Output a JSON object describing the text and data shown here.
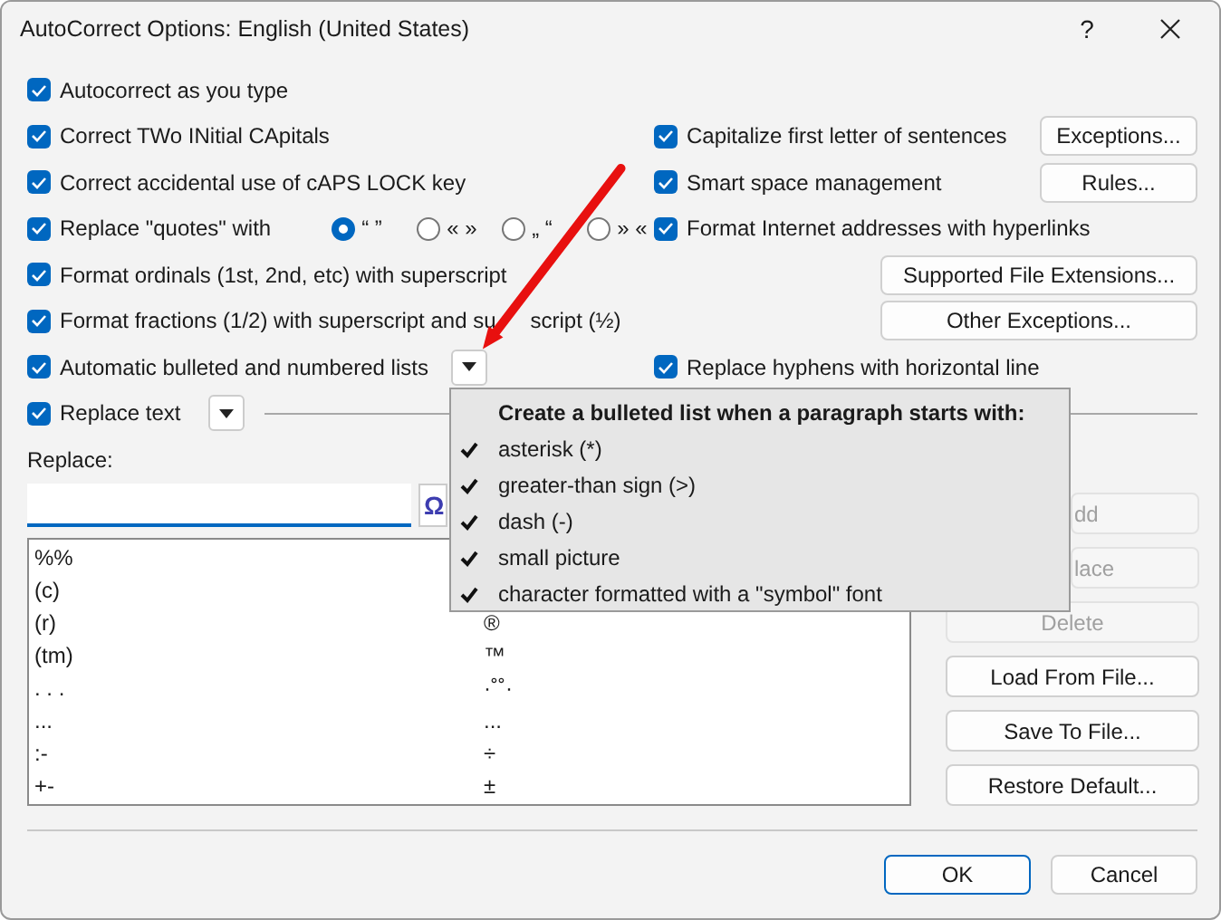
{
  "window": {
    "title": "AutoCorrect Options: English (United States)",
    "help": "?"
  },
  "rows": [
    {
      "left": {
        "kind": "checkbox",
        "label": "Autocorrect as you type",
        "checked": true
      }
    },
    {
      "left": {
        "kind": "checkbox",
        "label": "Correct TWo INitial CApitals",
        "checked": true
      },
      "right": {
        "kind": "checkbox",
        "label": "Capitalize first letter of sentences",
        "checked": true,
        "button": "Exceptions..."
      }
    },
    {
      "left": {
        "kind": "checkbox",
        "label": "Correct accidental use of cAPS LOCK key",
        "checked": true
      },
      "right": {
        "kind": "checkbox",
        "label": "Smart space management",
        "checked": true,
        "button": "Rules..."
      }
    },
    {
      "left": {
        "kind": "quotes",
        "label": "Replace \"quotes\" with",
        "checked": true,
        "options": [
          {
            "label": "“ ”",
            "selected": true
          },
          {
            "label": "« »",
            "selected": false
          },
          {
            "label": "„ “",
            "selected": false
          },
          {
            "label": "» «",
            "selected": false
          }
        ]
      },
      "right": {
        "kind": "checkbox",
        "label": "Format Internet addresses with hyperlinks",
        "checked": true
      }
    },
    {
      "left": {
        "kind": "checkbox",
        "label": "Format ordinals (1st, 2nd, etc) with superscript",
        "checked": true
      },
      "right": {
        "kind": "button",
        "label": "Supported File Extensions..."
      }
    },
    {
      "left": {
        "kind": "checkbox",
        "label": "Format fractions (1/2) with superscript and su",
        "label_rest": "script (½)",
        "checked": true
      },
      "right": {
        "kind": "button",
        "label": "Other Exceptions..."
      }
    },
    {
      "left": {
        "kind": "list",
        "label": "Automatic bulleted and numbered lists",
        "checked": true
      },
      "right": {
        "kind": "checkbox",
        "label": "Replace hyphens with horizontal line",
        "checked": true
      }
    }
  ],
  "replace_text": {
    "label": "Replace text",
    "checked": true
  },
  "replace_label": "Replace:",
  "symbol_button": "Ω",
  "table": {
    "rows": [
      {
        "replace": "%%"
      },
      {
        "replace": "(c)"
      },
      {
        "replace": "(r)",
        "with": "®"
      },
      {
        "replace": "(tm)",
        "with": "™"
      },
      {
        "replace": ". . .",
        "with": "·˚˚·"
      },
      {
        "replace": "...",
        "with": "..."
      },
      {
        "replace": ":-",
        "with": "÷"
      },
      {
        "replace": "+-",
        "with": "±"
      }
    ]
  },
  "side_buttons": [
    {
      "label": "dd",
      "disabled": true,
      "partial": true
    },
    {
      "label": "lace",
      "disabled": true,
      "partial": true
    },
    {
      "label": "Delete",
      "disabled": true
    },
    {
      "label": "Load From File...",
      "disabled": false
    },
    {
      "label": "Save To File...",
      "disabled": false
    },
    {
      "label": "Restore Default...",
      "disabled": false
    }
  ],
  "footer_buttons": [
    {
      "label": "OK",
      "default": true
    },
    {
      "label": "Cancel",
      "default": false
    }
  ],
  "menu": {
    "header": "Create a bulleted list when a paragraph starts with:",
    "items": [
      {
        "label": "asterisk (*)",
        "checked": true
      },
      {
        "label": "greater-than sign (>)",
        "checked": true
      },
      {
        "label": "dash (-)",
        "checked": true
      },
      {
        "label": "small picture",
        "checked": true
      },
      {
        "label": "character formatted with a \"symbol\" font",
        "checked": true
      }
    ]
  }
}
